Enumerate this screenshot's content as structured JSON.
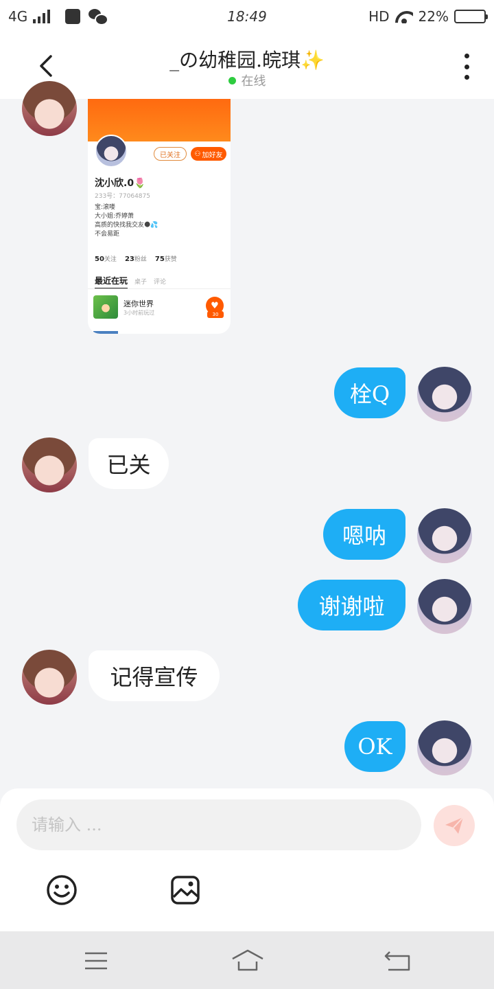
{
  "status_bar": {
    "network": "4G",
    "time": "18:49",
    "hd": "HD",
    "battery_text": "22%",
    "battery_level": 0.22,
    "battery_color": "#f5b800"
  },
  "header": {
    "title": "_の幼稚园.皖琪✨",
    "status": "在线",
    "back_icon": "chevron-left-icon",
    "more_icon": "more-vertical-icon"
  },
  "shared_card": {
    "follow_label": "已关注",
    "add_friend_label": "加好友",
    "name": "沈小欣.0🌷",
    "id_text": "233号：77064875",
    "bio_lines": [
      "宝:滚喽",
      "大小姐:乔婷萧",
      "高质的快找我交友🌑💦",
      "不会易距"
    ],
    "stats": [
      {
        "value": "50",
        "label": "关注"
      },
      {
        "value": "23",
        "label": "粉丝"
      },
      {
        "value": "75",
        "label": "获赞"
      }
    ],
    "tabs": [
      "最近在玩",
      "桌子",
      "评论"
    ],
    "game": {
      "name": "迷你世界",
      "time": "3小时前玩过",
      "likes": "30"
    }
  },
  "messages": [
    {
      "from": "self",
      "text": "栓Q"
    },
    {
      "from": "other",
      "text": "已关"
    },
    {
      "from": "self",
      "text": "嗯呐"
    },
    {
      "from": "self",
      "text": "谢谢啦"
    },
    {
      "from": "other",
      "text": "记得宣传"
    },
    {
      "from": "self",
      "text": "OK"
    }
  ],
  "input": {
    "placeholder": "请输入 ..."
  },
  "colors": {
    "self_bubble": "#1eaef5",
    "card_banner": "#ff6a10",
    "online": "#2ecc40",
    "send_button": "#fde0dc"
  },
  "icons": [
    "signal-icon",
    "wifi-icon",
    "battery-icon",
    "wechat-icon",
    "send-icon",
    "emoji-icon",
    "image-icon",
    "nav-menu-icon",
    "nav-home-icon",
    "nav-back-icon"
  ]
}
